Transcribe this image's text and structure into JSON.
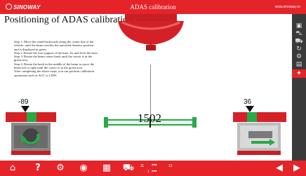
{
  "header": {
    "brand": "SINOWAY",
    "title": "ADAS calibration",
    "site": "www.sinoway.cn"
  },
  "page_title": "Positioning of ADAS calibration",
  "instructions": [
    "Step 1: Move the stand backwards along the center line of the vehicle, until the beam reaches the specified distance position and is displayed in green.",
    "Step 2: Rotate the foot support of the base, fix and level the base.",
    "Step 3: Rotate the beam center knob until the cursor is in the green area.",
    "Step 4: Rotate the knob in the middle of the beam to move the beam left or right until the cursor is in the green area.",
    "After completing the above steps, you can perform calibration operations such as ACC or LDW."
  ],
  "measurement": {
    "distance": "1502",
    "left_angle": "-89",
    "right_angle": "36"
  },
  "pager": {
    "page": "11",
    "total": "12",
    "sub": "1"
  },
  "colors": {
    "accent": "#e52429",
    "ok": "#2aa84a",
    "sidebar": "#3a3a3a"
  },
  "icons": {
    "sidebar": [
      "scan-icon",
      "car-front-icon",
      "car-side-icon",
      "refresh-icon",
      "wrench-icon",
      "printer-icon",
      "adas-icon"
    ],
    "bottom": [
      "home-icon",
      "help-icon",
      "settings-icon",
      "camera-icon",
      "grid-icon",
      "car-icon",
      "back-arrow-icon",
      "forward-arrow-icon"
    ]
  }
}
